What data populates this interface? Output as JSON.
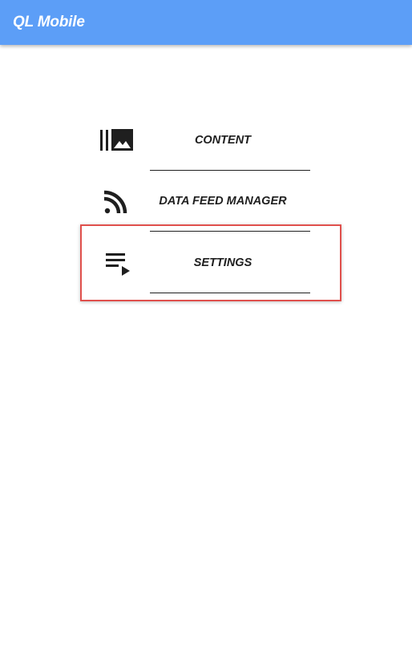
{
  "app": {
    "title": "QL Mobile",
    "accent_color": "#5c9ef7",
    "highlight_color": "#e0504c"
  },
  "menu": {
    "items": [
      {
        "label": "CONTENT",
        "icon": "content-library-icon"
      },
      {
        "label": "DATA FEED MANAGER",
        "icon": "rss-feed-icon"
      },
      {
        "label": "SETTINGS",
        "icon": "playlist-play-icon",
        "highlighted": true
      }
    ]
  }
}
